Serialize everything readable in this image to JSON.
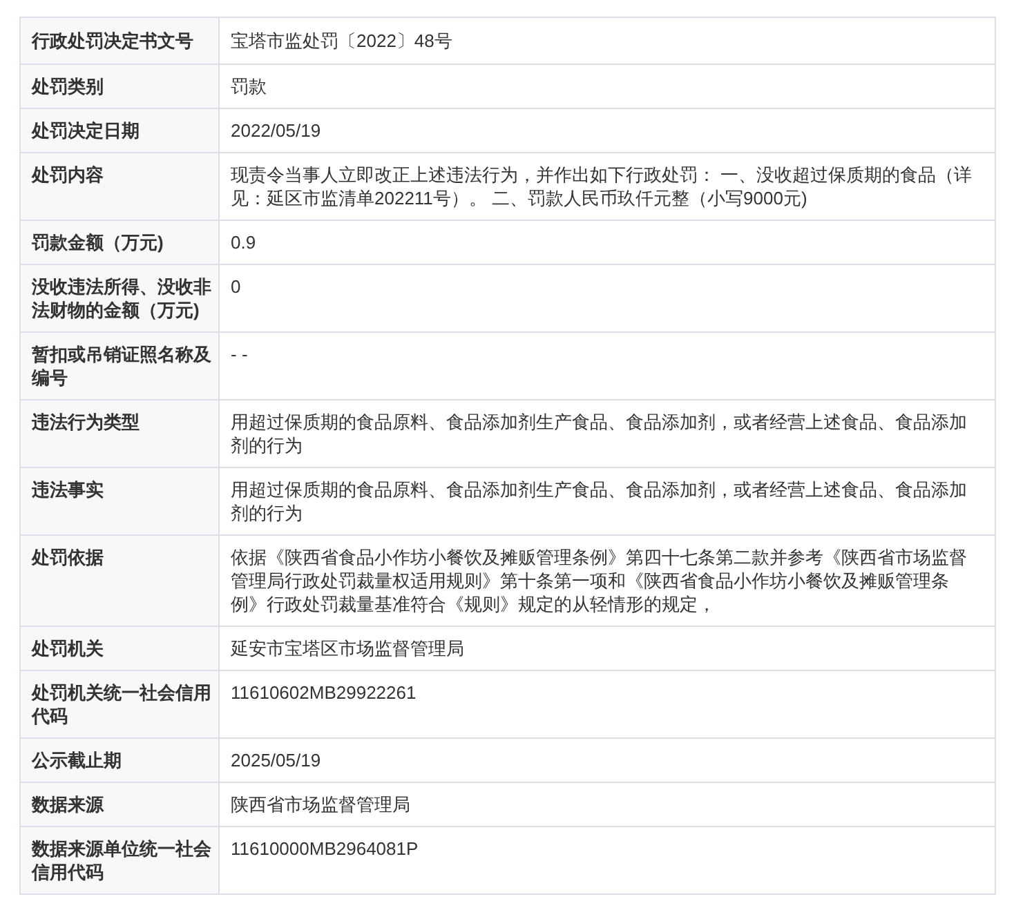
{
  "rows": [
    {
      "label": "行政处罚决定书文号",
      "value": "宝塔市监处罚〔2022〕48号"
    },
    {
      "label": "处罚类别",
      "value": "罚款"
    },
    {
      "label": "处罚决定日期",
      "value": "2022/05/19"
    },
    {
      "label": "处罚内容",
      "value": "现责令当事人立即改正上述违法行为，并作出如下行政处罚： 一、没收超过保质期的食品（详见：延区市监清单202211号）。 二、罚款人民币玖仟元整（小写9000元)"
    },
    {
      "label": "罚款金额（万元)",
      "value": "0.9"
    },
    {
      "label": "没收违法所得、没收非法财物的金额（万元)",
      "value": "0"
    },
    {
      "label": "暂扣或吊销证照名称及编号",
      "value": "- -"
    },
    {
      "label": "违法行为类型",
      "value": "用超过保质期的食品原料、食品添加剂生产食品、食品添加剂，或者经营上述食品、食品添加剂的行为"
    },
    {
      "label": "违法事实",
      "value": "用超过保质期的食品原料、食品添加剂生产食品、食品添加剂，或者经营上述食品、食品添加剂的行为"
    },
    {
      "label": "处罚依据",
      "value": "依据《陕西省食品小作坊小餐饮及摊贩管理条例》第四十七条第二款并参考《陕西省市场监督管理局行政处罚裁量权适用规则》第十条第一项和《陕西省食品小作坊小餐饮及摊贩管理条例》行政处罚裁量基准符合《规则》规定的从轻情形的规定，"
    },
    {
      "label": "处罚机关",
      "value": "延安市宝塔区市场监督管理局"
    },
    {
      "label": "处罚机关统一社会信用代码",
      "value": "11610602MB29922261"
    },
    {
      "label": "公示截止期",
      "value": "2025/05/19"
    },
    {
      "label": "数据来源",
      "value": "陕西省市场监督管理局"
    },
    {
      "label": "数据来源单位统一社会信用代码",
      "value": "11610000MB2964081P"
    }
  ]
}
